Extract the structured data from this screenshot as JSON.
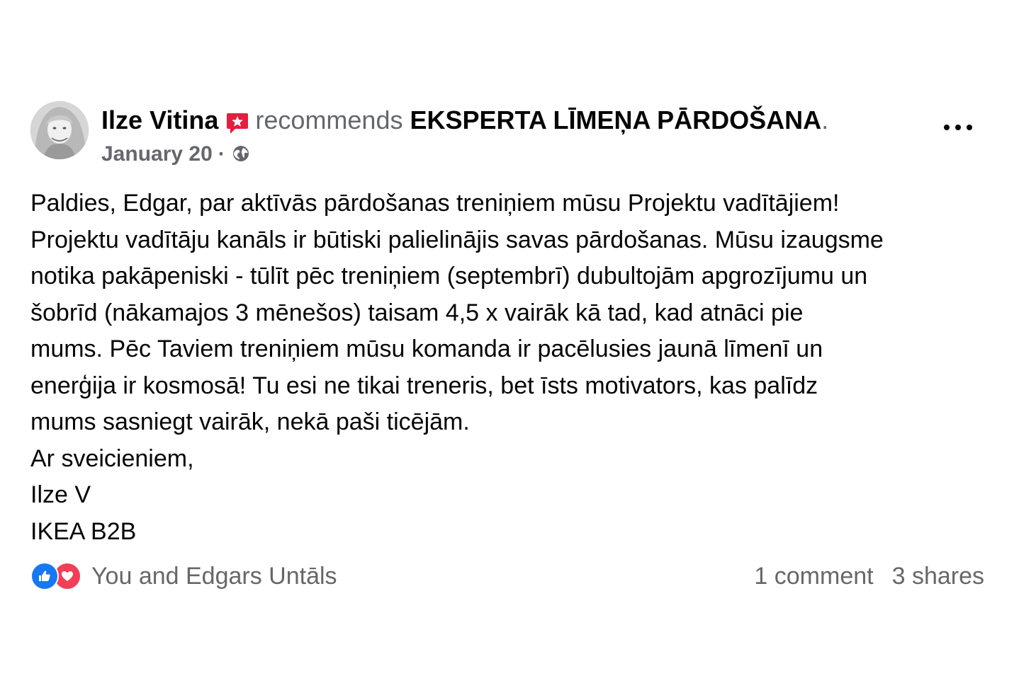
{
  "post": {
    "author": "Ilze Vitina",
    "action": "recommends",
    "page_name": "EKSPERTA LĪMEŅA PĀRDOŠANA",
    "trailing_punct": ".",
    "date": "January 20",
    "date_separator": "·",
    "privacy_icon": "globe-icon",
    "recommend_icon": "recommend-star-icon",
    "more_icon": "more-options-icon",
    "body_lines": [
      "Paldies, Edgar, par aktīvās pārdošanas treniņiem mūsu Projektu vadītājiem!",
      "Projektu vadītāju kanāls ir būtiski palielinājis savas pārdošanas. Mūsu izaugsme",
      "notika pakāpeniski - tūlīt pēc treniņiem (septembrī) dubultojām apgrozījumu un",
      "šobrīd (nākamajos 3 mēnešos) taisam 4,5 x vairāk kā tad, kad atnāci pie",
      "mums. Pēc Taviem treniņiem mūsu komanda ir pacēlusies jaunā līmenī un",
      "enerģija ir kosmosā! Tu esi ne tikai treneris, bet īsts motivators, kas palīdz",
      "mums sasniegt vairāk, nekā paši ticējām.",
      "Ar sveicieniem,",
      "Ilze V",
      "IKEA B2B"
    ]
  },
  "footer": {
    "reactions": [
      "like-icon",
      "love-icon"
    ],
    "reactor_names": "You and Edgars Untāls",
    "comments": "1 comment",
    "shares": "3 shares"
  },
  "colors": {
    "text": "#050505",
    "secondary": "#65676b",
    "like": "#1877f2",
    "love": "#f33e58",
    "recommend": "#e41e3f"
  }
}
